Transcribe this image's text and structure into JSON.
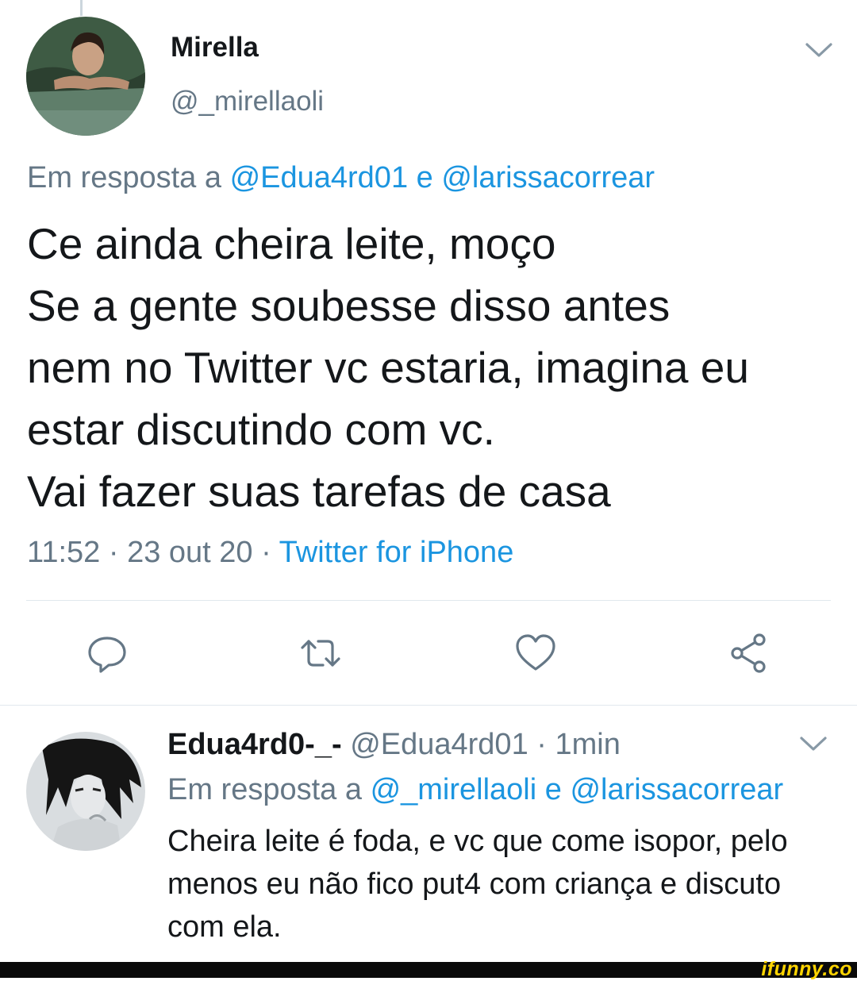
{
  "tweet": {
    "author_name": "Mirella",
    "author_handle": "@_mirellaoli",
    "reply_prefix": "Em resposta a",
    "reply_mention_1": "@Edua4rd01",
    "reply_joiner": "e",
    "reply_mention_2": "@larissacorrear",
    "text_lines": [
      "Ce ainda cheira leite, moço",
      "Se a gente soubesse disso antes",
      "nem no Twitter vc estaria, imagina eu",
      "estar discutindo com vc.",
      "Vai fazer suas tarefas de casa"
    ],
    "time": "11:52",
    "sep": "·",
    "date": "23 out 20",
    "source": "Twitter for iPhone"
  },
  "actions": {
    "reply_icon": "reply-icon",
    "retweet_icon": "retweet-icon",
    "like_icon": "like-icon",
    "share_icon": "share-icon"
  },
  "reply": {
    "author_name": "Edua4rd0-_-",
    "author_handle": "@Edua4rd01",
    "sep": "·",
    "time_ago": "1min",
    "reply_prefix": "Em resposta a",
    "reply_mention_1": "@_mirellaoli",
    "reply_joiner": "e",
    "reply_mention_2": "@larissacorrear",
    "text_lines": [
      "Cheira leite é foda, e vc que come isopor, pelo",
      "menos eu não fico put4 com criança e discuto",
      "com ela."
    ]
  },
  "watermark": "ifunny.co",
  "colors": {
    "link": "#1b95e0",
    "secondary_text": "#657786",
    "primary_text": "#14171a",
    "divider": "#e1e8ed"
  }
}
